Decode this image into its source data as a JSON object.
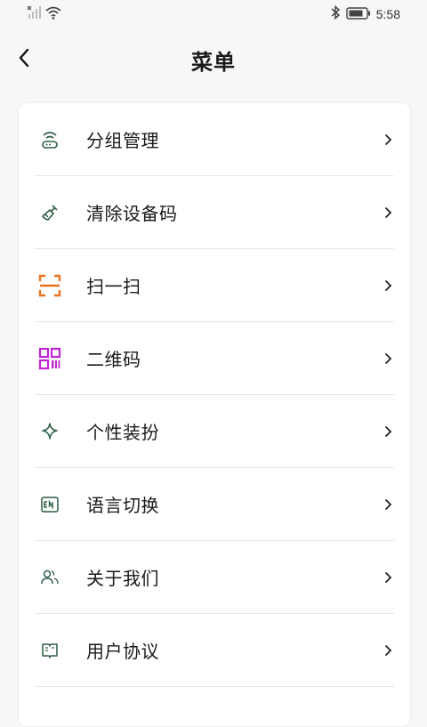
{
  "status_bar": {
    "time": "5:58"
  },
  "header": {
    "title": "菜单"
  },
  "menu": {
    "items": [
      {
        "label": "分组管理",
        "icon": "router-icon",
        "color": "#2e5d45"
      },
      {
        "label": "清除设备码",
        "icon": "broom-icon",
        "color": "#2e5d45"
      },
      {
        "label": "扫一扫",
        "icon": "scan-icon",
        "color": "#e8731e"
      },
      {
        "label": "二维码",
        "icon": "qr-code-icon",
        "color": "#c025d3"
      },
      {
        "label": "个性装扮",
        "icon": "sparkle-icon",
        "color": "#2e5d45"
      },
      {
        "label": "语言切换",
        "icon": "language-icon",
        "color": "#2e5d45"
      },
      {
        "label": "关于我们",
        "icon": "users-icon",
        "color": "#2e5d45"
      },
      {
        "label": "用户协议",
        "icon": "book-icon",
        "color": "#2e5d45"
      }
    ]
  }
}
